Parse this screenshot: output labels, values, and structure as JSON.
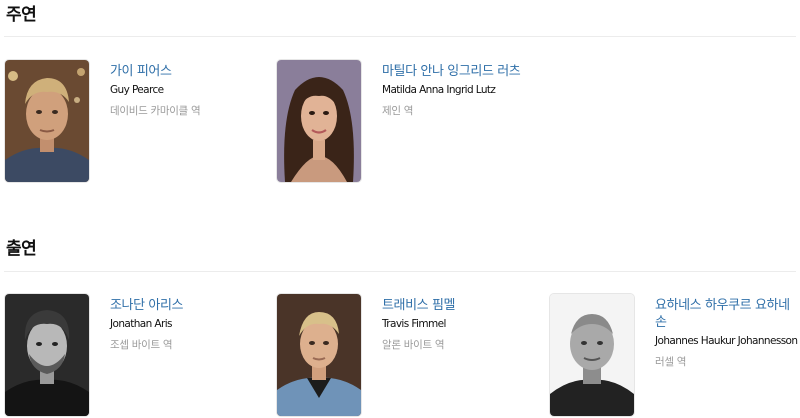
{
  "main_cast": {
    "title": "주연",
    "people": [
      {
        "name_ko": "가이 피어스",
        "name_en": "Guy Pearce",
        "role": "데이비드 카마이클 역"
      },
      {
        "name_ko": "마틸다 안나 잉그리드 러츠",
        "name_en": "Matilda Anna Ingrid Lutz",
        "role": "제인 역"
      }
    ]
  },
  "supporting_cast": {
    "title": "출연",
    "people": [
      {
        "name_ko": "조나단 아리스",
        "name_en": "Jonathan Aris",
        "role": "조셉 바이트 역"
      },
      {
        "name_ko": "트래비스 핌멜",
        "name_en": "Travis Fimmel",
        "role": "알론 바이트 역"
      },
      {
        "name_ko": "요하네스 하우쿠르 요하네손",
        "name_en": "Johannes Haukur Johannesson",
        "role": "러셀 역"
      }
    ]
  }
}
